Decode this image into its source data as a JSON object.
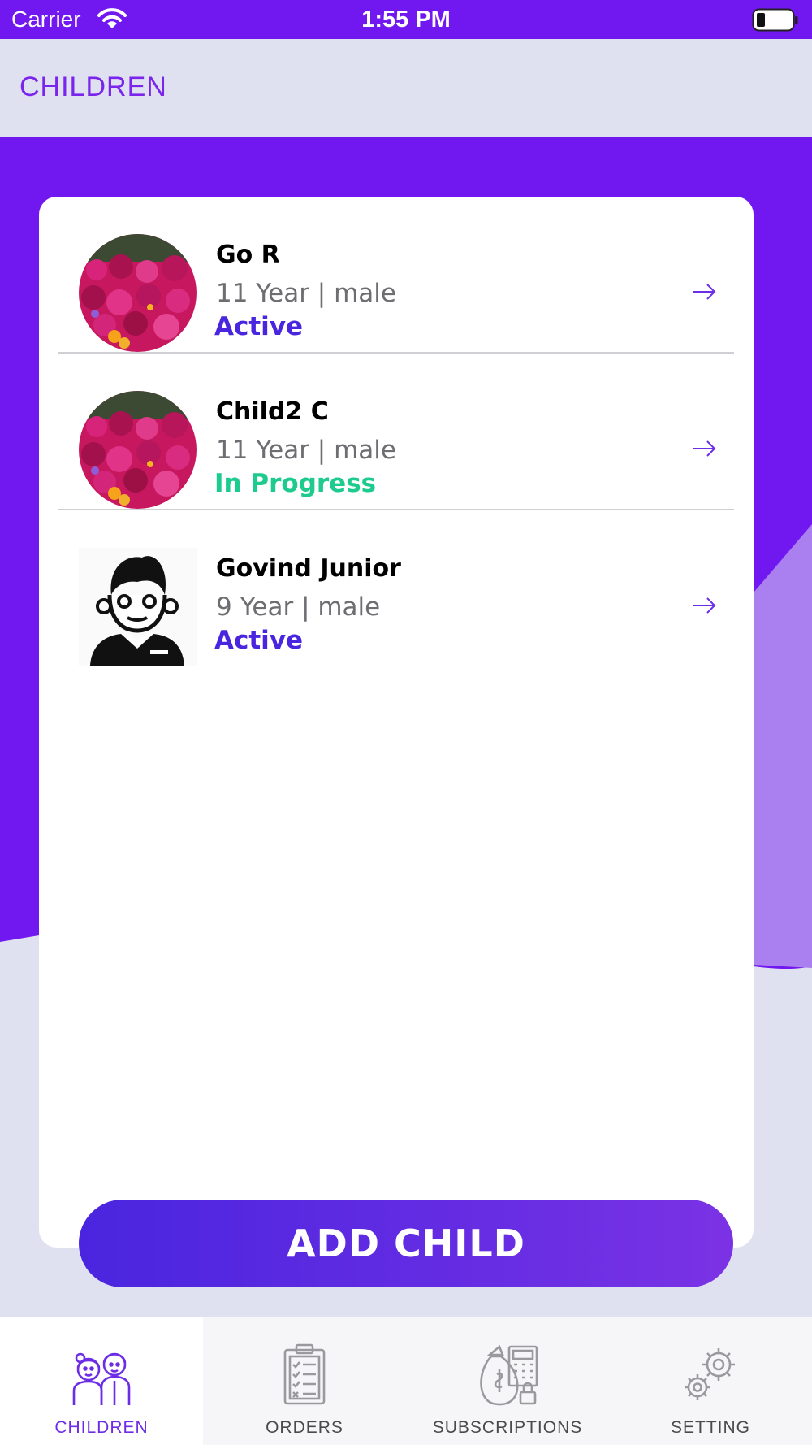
{
  "status_bar": {
    "carrier": "Carrier",
    "time": "1:55 PM"
  },
  "header": {
    "title": "CHILDREN"
  },
  "children": [
    {
      "name": "Go R",
      "meta": "11 Year | male",
      "status": "Active",
      "status_color": "#4a25df",
      "avatar": "flower-photo"
    },
    {
      "name": "Child2 C",
      "meta": "11 Year | male",
      "status": "In Progress",
      "status_color": "#1dcb8e",
      "avatar": "flower-photo"
    },
    {
      "name": "Govind Junior",
      "meta": "9 Year | male",
      "status": "Active",
      "status_color": "#4a25df",
      "avatar": "boy-cartoon-icon"
    }
  ],
  "add_button": {
    "label": "ADD CHILD"
  },
  "tabs": [
    {
      "label": "CHILDREN",
      "icon": "children-icon",
      "active": true
    },
    {
      "label": "ORDERS",
      "icon": "clipboard-icon",
      "active": false
    },
    {
      "label": "SUBSCRIPTIONS",
      "icon": "money-calculator-icon",
      "active": false
    },
    {
      "label": "SETTING",
      "icon": "gears-icon",
      "active": false
    }
  ],
  "colors": {
    "primary": "#7117ef",
    "accent": "#7a24ec",
    "active_status": "#4a25df",
    "progress_status": "#1dcb8e",
    "background": "#dfe1f1"
  }
}
